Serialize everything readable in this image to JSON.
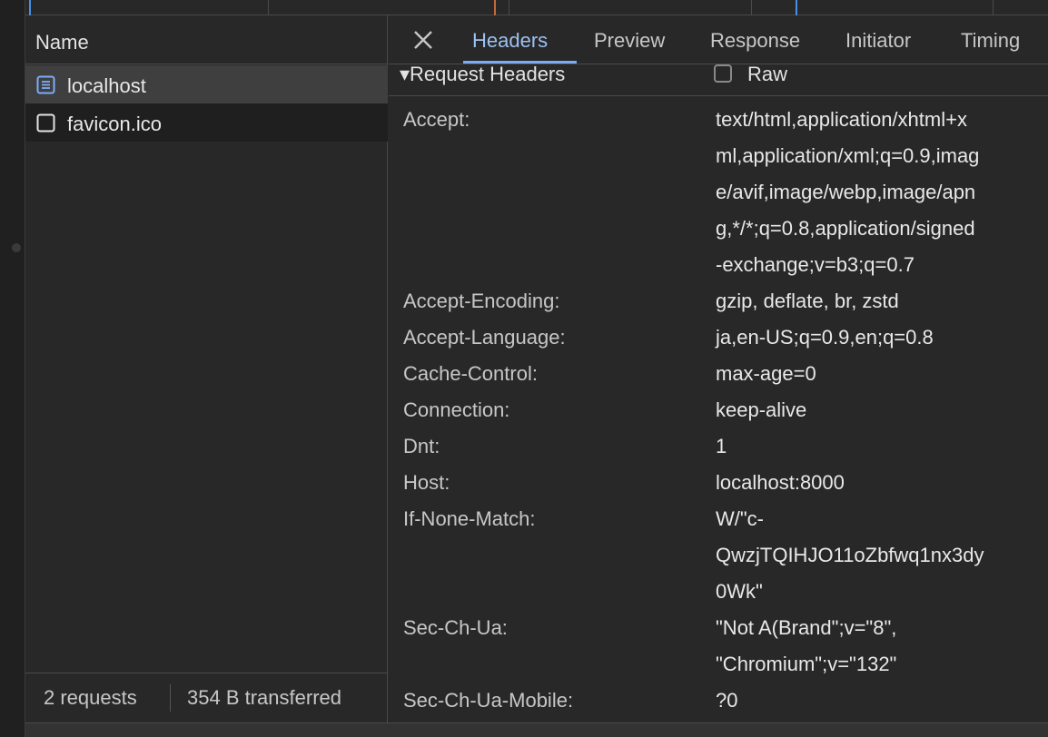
{
  "request_list": {
    "column_header": "Name",
    "rows": [
      {
        "name": "localhost",
        "icon": "document-icon"
      },
      {
        "name": "favicon.ico",
        "icon": "file-icon"
      }
    ],
    "footer": {
      "requests": "2 requests",
      "transferred": "354 B transferred"
    }
  },
  "details": {
    "tabs": [
      "Headers",
      "Preview",
      "Response",
      "Initiator",
      "Timing"
    ],
    "active_tab": "Headers",
    "section_title": "▾Request Headers",
    "raw_label": "Raw",
    "headers": [
      {
        "key": "Accept:",
        "lines": [
          "text/html,application/xhtml+x",
          "ml,application/xml;q=0.9,imag",
          "e/avif,image/webp,image/apn",
          "g,*/*;q=0.8,application/signed",
          "-exchange;v=b3;q=0.7"
        ]
      },
      {
        "key": "Accept-Encoding:",
        "lines": [
          "gzip, deflate, br, zstd"
        ]
      },
      {
        "key": "Accept-Language:",
        "lines": [
          "ja,en-US;q=0.9,en;q=0.8"
        ]
      },
      {
        "key": "Cache-Control:",
        "lines": [
          "max-age=0"
        ]
      },
      {
        "key": "Connection:",
        "lines": [
          "keep-alive"
        ]
      },
      {
        "key": "Dnt:",
        "lines": [
          "1"
        ]
      },
      {
        "key": "Host:",
        "lines": [
          "localhost:8000"
        ]
      },
      {
        "key": "If-None-Match:",
        "lines": [
          "W/\"c-",
          "QwzjTQIHJO11oZbfwq1nx3dy",
          "0Wk\""
        ]
      },
      {
        "key": "Sec-Ch-Ua:",
        "lines": [
          "\"Not A(Brand\";v=\"8\",",
          "\"Chromium\";v=\"132\""
        ]
      },
      {
        "key": "Sec-Ch-Ua-Mobile:",
        "lines": [
          "?0"
        ]
      }
    ]
  },
  "colors": {
    "background": "#282828",
    "accent": "#7cacf8",
    "active_tab_text": "#9cc1f2",
    "selected_row": "#3f3f3f"
  }
}
